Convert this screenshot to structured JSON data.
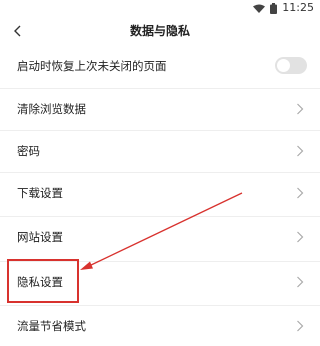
{
  "status_bar": {
    "time": "11:25"
  },
  "header": {
    "title": "数据与隐私"
  },
  "settings": {
    "restore_pages": {
      "label": "启动时恢复上次未关闭的页面",
      "enabled": false
    },
    "items": [
      {
        "label": "清除浏览数据"
      },
      {
        "label": "密码"
      },
      {
        "label": "下载设置"
      },
      {
        "label": "网站设置"
      },
      {
        "label": "隐私设置"
      },
      {
        "label": "流量节省模式"
      }
    ]
  },
  "annotation": {
    "color": "#d8322e"
  }
}
